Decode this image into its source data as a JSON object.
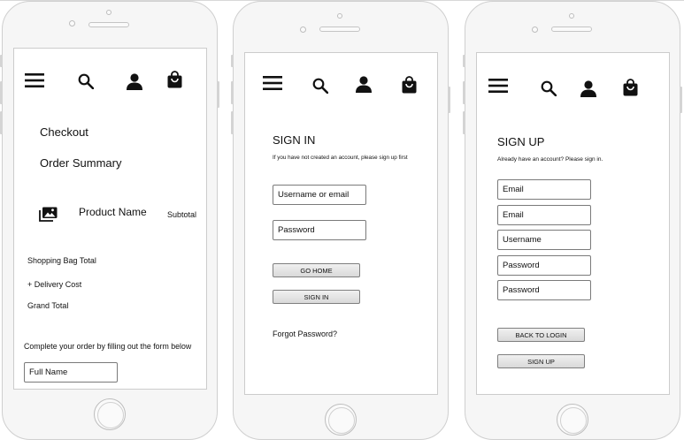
{
  "checkout": {
    "title": "Checkout",
    "order_summary": "Order Summary",
    "product_name": "Product Name",
    "subtotal": "Subtotal",
    "shopping_bag_total": "Shopping Bag Total",
    "delivery_cost": "+ Delivery Cost",
    "grand_total": "Grand Total",
    "form_instruction": "Complete your order by filling out the form below",
    "full_name_placeholder": "Full Name"
  },
  "signin": {
    "title": "SIGN IN",
    "subtitle": "If you have not created an account, please sign up first",
    "username_placeholder": "Username or email",
    "password_placeholder": "Password",
    "go_home_label": "GO HOME",
    "sign_in_label": "SIGN IN",
    "forgot_password": "Forgot Password?"
  },
  "signup": {
    "title": "SIGN UP",
    "subtitle": "Already have an account? Please sign in.",
    "fields": [
      "Email",
      "Email",
      "Username",
      "Password",
      "Password"
    ],
    "back_to_login_label": "BACK TO LOGIN",
    "sign_up_label": "SIGN UP"
  },
  "nav_icons": [
    "menu-icon",
    "search-icon",
    "user-icon",
    "shopping-bag-icon"
  ],
  "colors": {
    "phone_frame": "#f6f6f6",
    "screen": "#ffffff",
    "button_fill": "#e3e3e3",
    "field_border": "#7a7a7a"
  }
}
